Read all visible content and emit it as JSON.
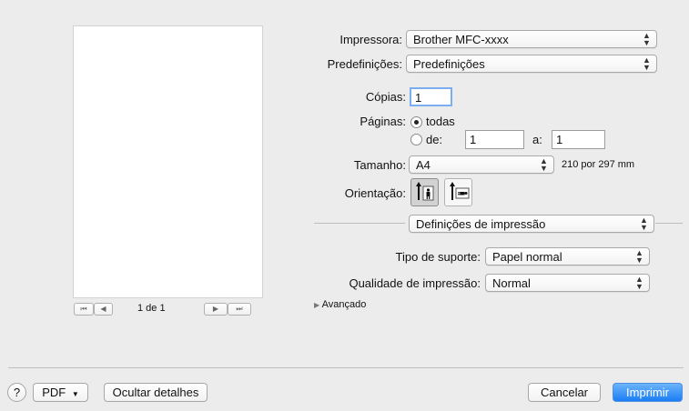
{
  "preview": {
    "page_indicator": "1 de 1"
  },
  "printer": {
    "label": "Impressora:",
    "value": "Brother MFC-xxxx"
  },
  "presets": {
    "label": "Predefinições:",
    "value": "Predefinições"
  },
  "copies": {
    "label": "Cópias:",
    "value": "1"
  },
  "pages": {
    "label": "Páginas:",
    "all_label": "todas",
    "from_label": "de:",
    "from_value": "1",
    "to_label": "a:",
    "to_value": "1",
    "selected": "todas"
  },
  "size": {
    "label": "Tamanho:",
    "value": "A4",
    "dimensions": "210 por 297 mm"
  },
  "orientation": {
    "label": "Orientação:",
    "selected": "portrait"
  },
  "section": {
    "value": "Definições de impressão"
  },
  "media_type": {
    "label": "Tipo de suporte:",
    "value": "Papel normal"
  },
  "print_quality": {
    "label": "Qualidade de impressão:",
    "value": "Normal"
  },
  "advanced": {
    "label": "Avançado"
  },
  "footer": {
    "help": "?",
    "pdf": "PDF",
    "hide_details": "Ocultar detalhes",
    "cancel": "Cancelar",
    "print": "Imprimir"
  }
}
